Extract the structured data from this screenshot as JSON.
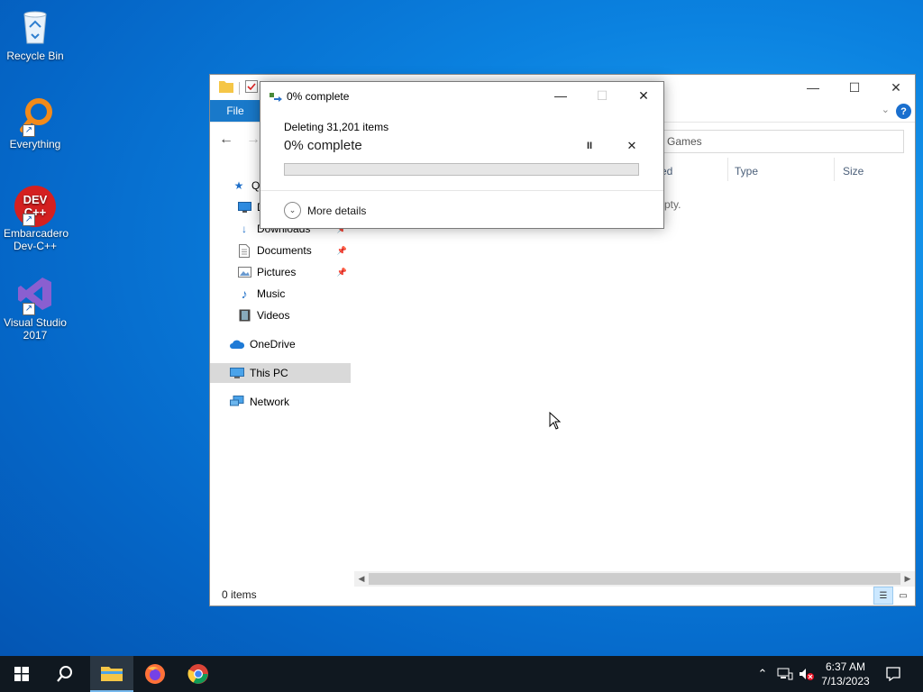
{
  "desktop": {
    "icons": [
      {
        "label": "Recycle Bin"
      },
      {
        "label": "Everything"
      },
      {
        "label": "Embarcadero Dev-C++"
      },
      {
        "label": "Visual Studio 2017"
      }
    ]
  },
  "explorer": {
    "file_tab": "File",
    "help": "?",
    "search_placeholder": "Games",
    "nav": {
      "quick_access": "Qu",
      "desktop": "D",
      "downloads": "Downloads",
      "documents": "Documents",
      "pictures": "Pictures",
      "music": "Music",
      "videos": "Videos",
      "onedrive": "OneDrive",
      "this_pc": "This PC",
      "network": "Network"
    },
    "columns": {
      "modified": "ed",
      "type": "Type",
      "size": "Size"
    },
    "empty_text": "pty.",
    "status": "0 items"
  },
  "dialog": {
    "title": "0% complete",
    "subtitle": "Deleting 31,201 items",
    "main": "0% complete",
    "progress_percent": 0,
    "more_details": "More details",
    "pause": "II",
    "stop": "✕"
  },
  "taskbar": {
    "time": "6:37 AM",
    "date": "7/13/2023"
  },
  "colors": {
    "accent": "#1979ca",
    "progress": "#06b025",
    "taskbar": "#101820"
  }
}
